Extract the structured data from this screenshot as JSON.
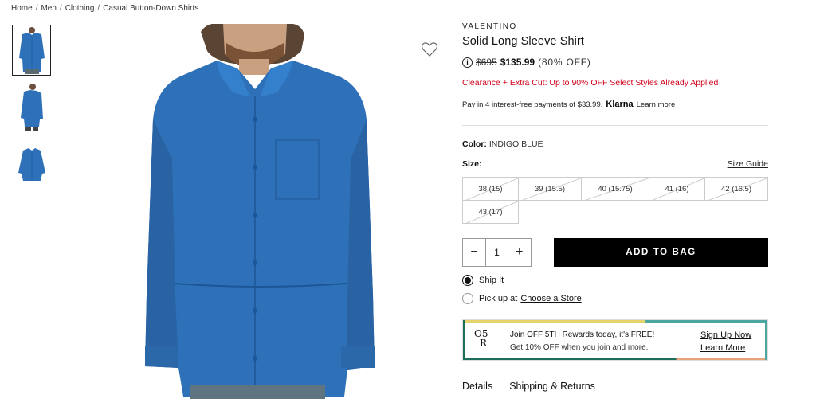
{
  "breadcrumb": [
    {
      "label": "Home"
    },
    {
      "label": "Men"
    },
    {
      "label": "Clothing"
    },
    {
      "label": "Casual Button-Down Shirts"
    }
  ],
  "product": {
    "brand": "VALENTINO",
    "name": "Solid Long Sleeve Shirt",
    "original_price": "$695",
    "sale_price": "$135.99",
    "discount": "(80% OFF)",
    "promo": "Clearance + Extra Cut: Up to 90% OFF Select Styles Already Applied",
    "installments_text": "Pay in 4 interest-free payments of $33.99.",
    "klarna_label": "Klarna",
    "learn_more": "Learn more",
    "color_label": "Color:",
    "color_value": "INDIGO BLUE",
    "size_label": "Size:",
    "size_guide": "Size Guide",
    "sizes": [
      {
        "label": "38 (15)",
        "available": false
      },
      {
        "label": "39 (15.5)",
        "available": false
      },
      {
        "label": "40 (15.75)",
        "available": false
      },
      {
        "label": "41 (16)",
        "available": false
      },
      {
        "label": "42 (16.5)",
        "available": false
      },
      {
        "label": "43 (17)",
        "available": false
      }
    ],
    "image_color": "#2e71b8"
  },
  "purchase": {
    "minus": "−",
    "quantity": "1",
    "plus": "+",
    "add_to_bag": "ADD TO BAG",
    "ship_it": "Ship It",
    "pick_up_prefix": "Pick up at",
    "choose_store": "Choose a Store",
    "ship_selected": true
  },
  "rewards": {
    "logo_top": "O5",
    "logo_bottom": "R",
    "title": "Join OFF 5TH Rewards today, it's FREE!",
    "subtitle": "Get 10% OFF when you join and more.",
    "sign_up": "Sign Up Now",
    "learn_more": "Learn More"
  },
  "tabs": [
    {
      "label": "Details"
    },
    {
      "label": "Shipping & Returns"
    }
  ],
  "icons": {
    "wishlist": "heart-outline-icon",
    "info": "info-icon"
  }
}
